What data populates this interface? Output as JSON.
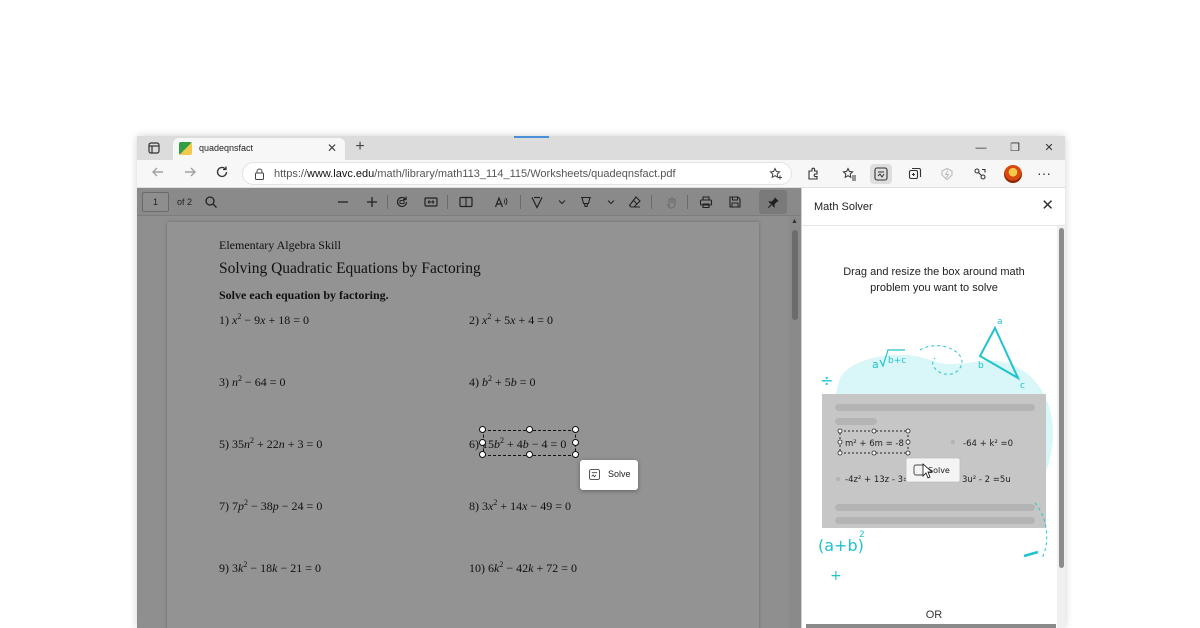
{
  "browser": {
    "tab": {
      "title": "quadeqnsfact",
      "close_label": "✕"
    },
    "new_tab_label": "+",
    "window_controls": {
      "minimize": "—",
      "restore": "❐",
      "close": "✕"
    },
    "address": {
      "prefix": "https://",
      "host": "www.lavc.edu",
      "path": "/math/library/math113_114_115/Worksheets/quadeqnsfact.pdf"
    },
    "menu_label": "···",
    "toolbar_icons": [
      "back-icon",
      "forward-icon",
      "refresh-icon",
      "lock-icon",
      "favorite-add-icon",
      "extensions-icon",
      "favorites-icon",
      "math-solver-icon",
      "collections-icon",
      "performance-icon",
      "share-icon",
      "profile-icon",
      "menu-icon"
    ]
  },
  "pdf": {
    "toolbar": {
      "page_number": "1",
      "page_of": "of 2"
    },
    "document": {
      "subtitle": "Elementary Algebra Skill",
      "title": "Solving Quadratic Equations by Factoring",
      "instruction": "Solve each equation by factoring.",
      "problems": [
        {
          "num": "1)",
          "html": "<i>x</i><sup>2</sup> − 9<i>x</i> + 18 = 0"
        },
        {
          "num": "2)",
          "html": "<i>x</i><sup>2</sup> + 5<i>x</i> + 4 = 0"
        },
        {
          "num": "3)",
          "html": "<i>n</i><sup>2</sup> − 64 = 0"
        },
        {
          "num": "4)",
          "html": "<i>b</i><sup>2</sup> + 5<i>b</i> = 0"
        },
        {
          "num": "5)",
          "html": "35<i>n</i><sup>2</sup> + 22<i>n</i> + 3 = 0"
        },
        {
          "num": "6)",
          "html": "15<i>b</i><sup>2</sup> + 4<i>b</i> − 4 = 0"
        },
        {
          "num": "7)",
          "html": "7<i>p</i><sup>2</sup> − 38<i>p</i> − 24 = 0"
        },
        {
          "num": "8)",
          "html": "3<i>x</i><sup>2</sup> + 14<i>x</i> − 49 = 0"
        },
        {
          "num": "9)",
          "html": "3<i>k</i><sup>2</sup> − 18<i>k</i> − 21 = 0"
        },
        {
          "num": "10)",
          "html": "6<i>k</i><sup>2</sup> − 42<i>k</i> + 72 = 0"
        }
      ]
    },
    "solve_popup_label": "Solve"
  },
  "solver": {
    "title": "Math Solver",
    "close_label": "✕",
    "instruction": "Drag and resize the box around math problem you want to solve",
    "illustration": {
      "eq1": "m² + 6m = -8",
      "eq2": "-64 + k² =0",
      "eq3": "-4z² + 13z - 3=",
      "eq4": "3u² - 2   =5u",
      "solve_label": "Solve",
      "triangle_labels": [
        "a",
        "b",
        "c"
      ]
    },
    "or_label": "OR"
  }
}
